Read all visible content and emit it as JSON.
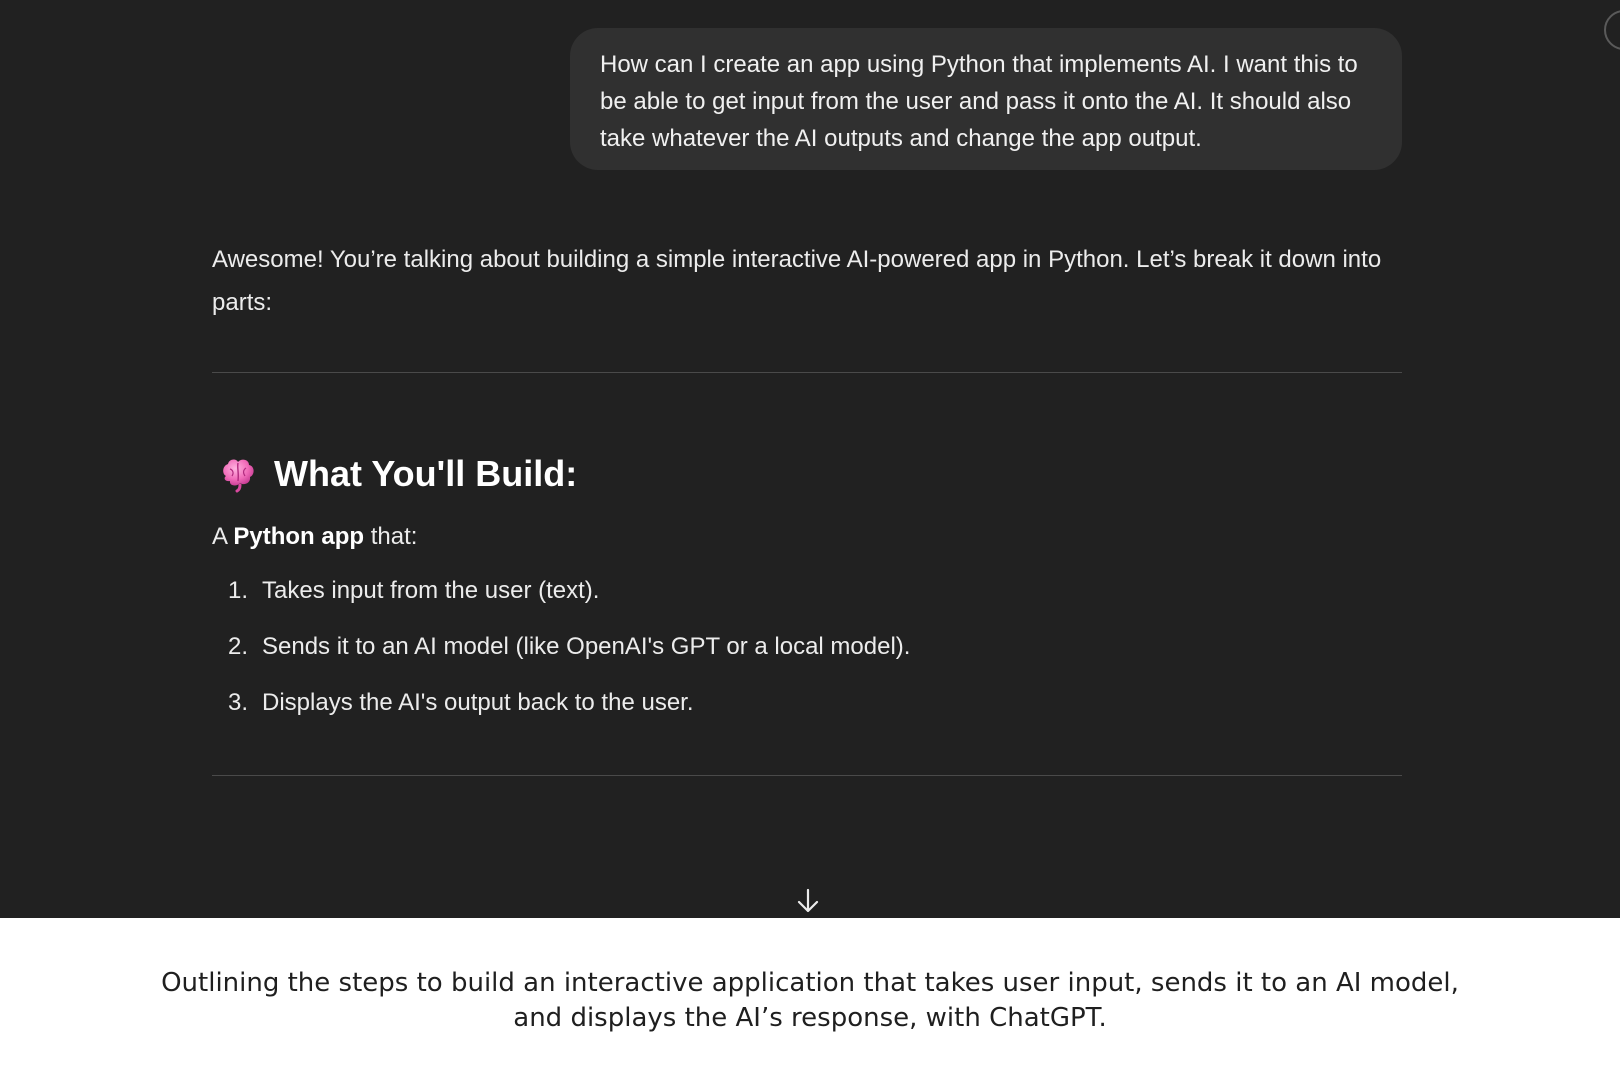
{
  "user_message": {
    "text": "How can I create an app using Python that implements AI. I want this to be able to get input from the user and pass it onto the AI. It should also take whatever the AI outputs and change the app output."
  },
  "assistant": {
    "intro": "Awesome! You’re talking about building a simple interactive AI-powered app in Python. Let’s break it down into parts:",
    "section_icon": "brain-icon",
    "section_title": "What You'll Build:",
    "lead": {
      "prefix": "A ",
      "bold": "Python app",
      "suffix": " that:"
    },
    "steps": [
      {
        "num": "1.",
        "text": "Takes input from the user (text)."
      },
      {
        "num": "2.",
        "text": "Sends it to an AI model (like OpenAI's GPT or a local model)."
      },
      {
        "num": "3.",
        "text": "Displays the AI's output back to the user."
      }
    ]
  },
  "scroll_button": {
    "icon": "arrow-down-icon"
  },
  "caption": {
    "line1": "Outlining the steps to build an interactive application that takes user input, sends it to an AI model,",
    "line2": "and displays the AI’s response, with ChatGPT."
  },
  "colors": {
    "chat_background": "#212121",
    "bubble_background": "#303030",
    "text": "#ececec",
    "caption_background": "#ffffff"
  }
}
